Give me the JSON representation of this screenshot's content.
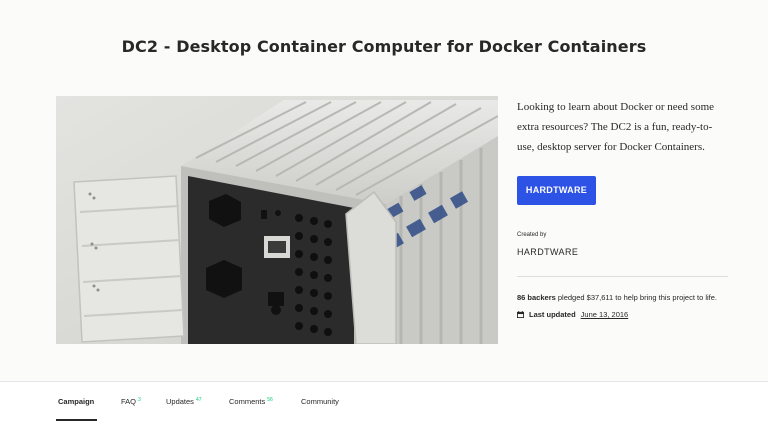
{
  "project": {
    "title": "DC2 - Desktop Container Computer for Docker Containers",
    "blurb": "Looking to learn about Docker or need some extra resources? The DC2 is a fun, ready-to-use, desktop server for Docker Containers.",
    "media_alt": "white shipping-container shaped desktop computer with doors open"
  },
  "creator": {
    "button_label": "HARDTWARE",
    "created_by_label": "Created by",
    "name": "HARDTWARE"
  },
  "stats": {
    "backers": "86 backers",
    "pledged_text": " pledged $37,611 to help bring this project to life."
  },
  "updated": {
    "label": "Last updated",
    "date": "June 13, 2016",
    "icon": "calendar-icon"
  },
  "tabs": [
    {
      "label": "Campaign",
      "count": ""
    },
    {
      "label": "FAQ",
      "count": "3"
    },
    {
      "label": "Updates",
      "count": "47"
    },
    {
      "label": "Comments",
      "count": "56"
    },
    {
      "label": "Community",
      "count": ""
    }
  ],
  "colors": {
    "accent_blue": "#2d52e6",
    "count_green": "#05ce78",
    "text": "#282828",
    "hero_bg": "#fbfbfa"
  }
}
